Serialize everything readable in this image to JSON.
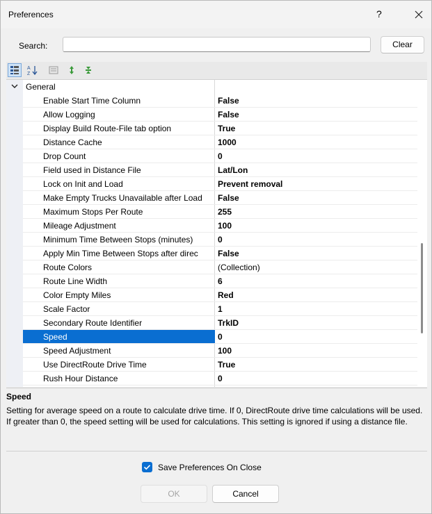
{
  "window": {
    "title": "Preferences",
    "help_glyph": "?",
    "close_glyph": "✕"
  },
  "search": {
    "label": "Search:",
    "value": "",
    "clear_label": "Clear"
  },
  "toolbar": {
    "icons": [
      "categorized-icon",
      "alphabetical-sort-icon",
      "property-pages-icon",
      "expand-icon",
      "collapse-icon"
    ]
  },
  "grid": {
    "category": {
      "label": "General",
      "expanded": true
    },
    "rows": [
      {
        "name": "Enable Start Time Column",
        "value": "False"
      },
      {
        "name": "Allow Logging",
        "value": "False"
      },
      {
        "name": "Display Build Route-File tab option",
        "value": "True"
      },
      {
        "name": "Distance Cache",
        "value": "1000"
      },
      {
        "name": "Drop Count",
        "value": "0"
      },
      {
        "name": "Field used in Distance File",
        "value": "Lat/Lon"
      },
      {
        "name": "Lock on Init and Load",
        "value": "Prevent removal"
      },
      {
        "name": "Make Empty Trucks Unavailable after Load",
        "value": "False"
      },
      {
        "name": "Maximum Stops Per Route",
        "value": "255"
      },
      {
        "name": "Mileage Adjustment",
        "value": "100"
      },
      {
        "name": "Minimum Time Between Stops (minutes)",
        "value": "0"
      },
      {
        "name": "Apply Min Time Between Stops after direc",
        "value": "False"
      },
      {
        "name": "Route Colors",
        "value": "(Collection)",
        "bold": false
      },
      {
        "name": "Route Line Width",
        "value": "6"
      },
      {
        "name": "Color Empty Miles",
        "value": "Red"
      },
      {
        "name": "Scale Factor",
        "value": "1"
      },
      {
        "name": "Secondary Route Identifier",
        "value": "TrkID"
      },
      {
        "name": "Speed",
        "value": "0",
        "selected": true
      },
      {
        "name": "Speed Adjustment",
        "value": "100"
      },
      {
        "name": "Use DirectRoute Drive Time",
        "value": "True"
      },
      {
        "name": "Rush Hour Distance",
        "value": "0"
      }
    ]
  },
  "description": {
    "title": "Speed",
    "text": "Setting for average speed on a route to calculate drive time. If 0, DirectRoute drive time calculations will be used. If greater than 0, the speed setting will be used for calculations. This setting is ignored if using a distance file."
  },
  "footer": {
    "save_on_close_label": "Save Preferences On Close",
    "save_on_close_checked": true,
    "ok_label": "OK",
    "cancel_label": "Cancel"
  },
  "colors": {
    "accent": "#0a6ed1"
  }
}
